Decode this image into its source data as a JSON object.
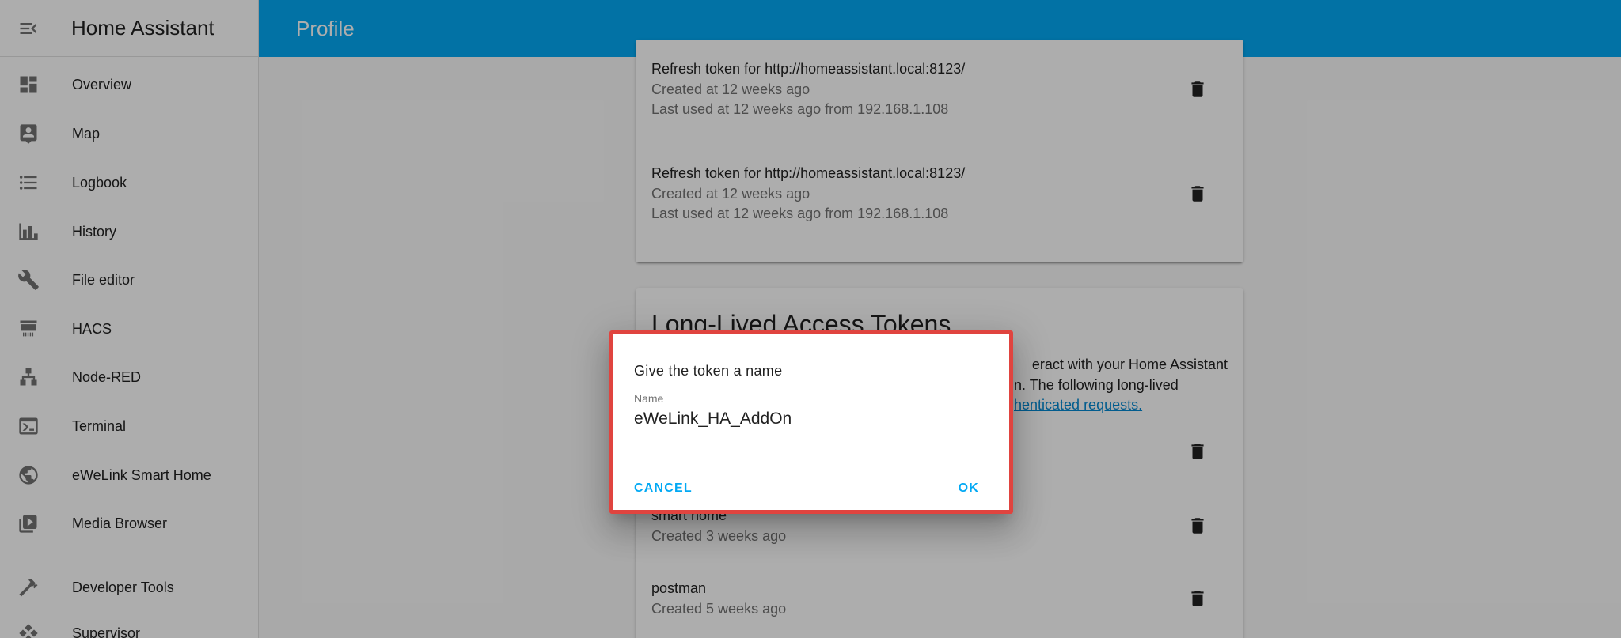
{
  "app": {
    "title": "Home Assistant"
  },
  "topbar": {
    "title": "Profile"
  },
  "sidebar": {
    "items": [
      {
        "label": "Overview",
        "icon": "dashboard-icon"
      },
      {
        "label": "Map",
        "icon": "map-icon"
      },
      {
        "label": "Logbook",
        "icon": "list-icon"
      },
      {
        "label": "History",
        "icon": "chart-icon"
      },
      {
        "label": "File editor",
        "icon": "wrench-icon"
      },
      {
        "label": "HACS",
        "icon": "hacs-icon"
      },
      {
        "label": "Node-RED",
        "icon": "sitemap-icon"
      },
      {
        "label": "Terminal",
        "icon": "terminal-icon"
      },
      {
        "label": "eWeLink Smart Home",
        "icon": "globe-icon"
      },
      {
        "label": "Media Browser",
        "icon": "play-box-icon"
      },
      {
        "label": "Developer Tools",
        "icon": "hammer-icon"
      },
      {
        "label": "Supervisor",
        "icon": "supervisor-icon"
      }
    ]
  },
  "refresh_tokens": [
    {
      "name": "Refresh token for http://homeassistant.local:8123/",
      "created": "Created at 12 weeks ago",
      "last_used": "Last used at 12 weeks ago from 192.168.1.108"
    },
    {
      "name": "Refresh token for http://homeassistant.local:8123/",
      "created": "Created at 12 weeks ago",
      "last_used": "Last used at 12 weeks ago from 192.168.1.108"
    }
  ],
  "long_lived": {
    "title": "Long-Lived Access Tokens",
    "desc_line1": "eract with your Home Assistant",
    "desc_line2": "n. The following long-lived",
    "desc_link": "henticated requests.",
    "tokens": [
      {
        "name": "smart home",
        "created": "Created 3 weeks ago"
      },
      {
        "name": "postman",
        "created": "Created 5 weeks ago"
      }
    ]
  },
  "dialog": {
    "title": "Give the token a name",
    "field_label": "Name",
    "field_value": "eWeLink_HA_AddOn",
    "cancel_label": "CANCEL",
    "ok_label": "OK"
  },
  "colors": {
    "primary": "#03a9f4",
    "highlight_border": "#e0443f"
  }
}
